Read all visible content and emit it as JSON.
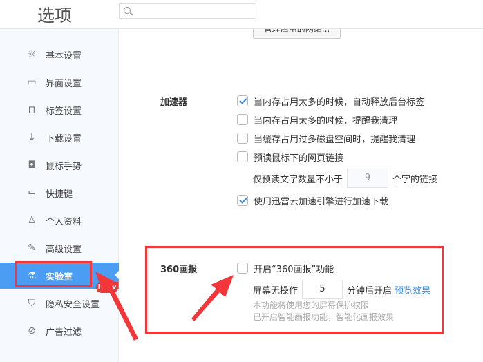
{
  "header": {
    "title": "选项",
    "search_placeholder": ""
  },
  "sidebar": {
    "items": [
      {
        "label": "基本设置",
        "icon": "sun-icon",
        "glyph": "☼"
      },
      {
        "label": "界面设置",
        "icon": "window-icon",
        "glyph": "▭"
      },
      {
        "label": "标签设置",
        "icon": "tab-icon",
        "glyph": "⊓"
      },
      {
        "label": "下载设置",
        "icon": "download-icon",
        "glyph": "↓"
      },
      {
        "label": "鼠标手势",
        "icon": "mouse-icon",
        "glyph": "◘"
      },
      {
        "label": "快捷键",
        "icon": "shortcut-icon",
        "glyph": "⌙"
      },
      {
        "label": "个人资料",
        "icon": "user-icon",
        "glyph": "♙"
      },
      {
        "label": "高级设置",
        "icon": "wrench-icon",
        "glyph": "✎"
      },
      {
        "label": "实验室",
        "icon": "flask-icon",
        "glyph": "⚗",
        "active": true
      },
      {
        "label": "隐私安全设置",
        "icon": "shield-icon",
        "glyph": "⛉"
      },
      {
        "label": "广告过滤",
        "icon": "block-icon",
        "glyph": "⊘"
      }
    ],
    "new_badge": "New"
  },
  "main": {
    "manage_button": "管理启用的网站...",
    "accelerator": {
      "title": "加速器",
      "options": [
        {
          "label": "当内存占用太多的时候，自动释放后台标签",
          "checked": true
        },
        {
          "label": "当内存占用太多的时候，提醒我清理",
          "checked": false
        },
        {
          "label": "当缓存占用过多磁盘空间时，提醒我清理",
          "checked": false
        },
        {
          "label": "预读鼠标下的网页链接",
          "checked": false
        }
      ],
      "preread_prefix": "仅预读文字数量不小于",
      "preread_value": "9",
      "preread_suffix": "个字的链接",
      "xunlei": {
        "label": "使用迅雷云加速引擎进行加速下载",
        "checked": true
      }
    },
    "pictorial": {
      "title": "360画报",
      "enable_label": "开启“360画报”功能",
      "enabled": false,
      "idle_prefix": "屏幕无操作",
      "idle_value": "5",
      "idle_suffix": "分钟后开启",
      "preview_link": "预览效果",
      "hint1": "本功能将使用您的屏幕保护权限",
      "hint2": "已开启智能画报功能，智能化画报效果"
    }
  },
  "colors": {
    "accent": "#4a9df3",
    "annotation": "#f3363a"
  }
}
